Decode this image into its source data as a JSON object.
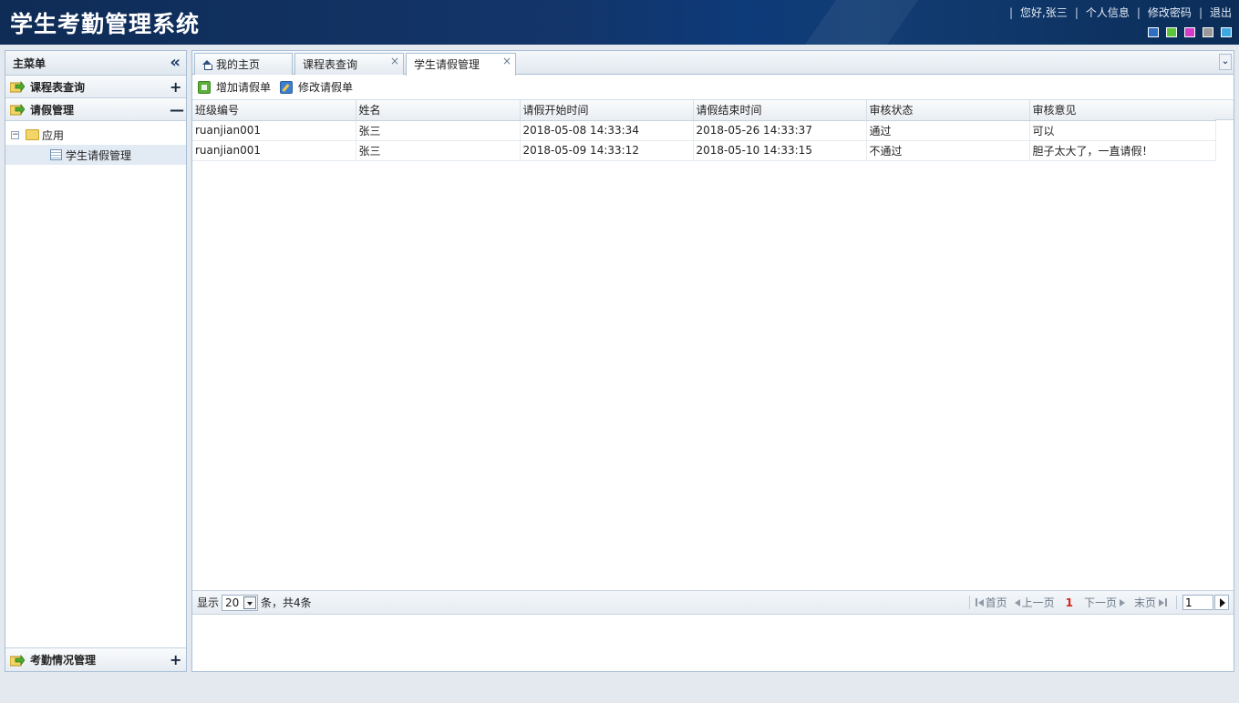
{
  "header": {
    "title": "学生考勤管理系统",
    "greeting": "您好,张三",
    "links": [
      "个人信息",
      "修改密码",
      "退出"
    ],
    "theme_colors": [
      "#2d6fc2",
      "#5cc43a",
      "#d63ac8",
      "#9a9a9a",
      "#40a8e0"
    ]
  },
  "sidebar": {
    "title": "主菜单",
    "panels": [
      {
        "label": "课程表查询",
        "toggle": "+"
      },
      {
        "label": "请假管理",
        "toggle": "—"
      },
      {
        "label": "考勤情况管理",
        "toggle": "+"
      }
    ],
    "tree": {
      "folder": "应用",
      "expander": "−",
      "item": "学生请假管理"
    }
  },
  "tabs": [
    {
      "label": "我的主页"
    },
    {
      "label": "课程表查询",
      "close": "×"
    },
    {
      "label": "学生请假管理",
      "close": "×"
    }
  ],
  "tab_menu": "¥",
  "toolbar": {
    "add_label": "增加请假单",
    "edit_label": "修改请假单"
  },
  "grid": {
    "columns": [
      "班级编号",
      "姓名",
      "请假开始时间",
      "请假结束时间",
      "审核状态",
      "审核意见"
    ],
    "rows": [
      [
        "ruanjian001",
        "张三",
        "2018-05-08 14:33:34",
        "2018-05-26 14:33:37",
        "通过",
        "可以"
      ],
      [
        "ruanjian001",
        "张三",
        "2018-05-09 14:33:12",
        "2018-05-10 14:33:15",
        "不通过",
        "胆子太大了，一直请假！"
      ]
    ]
  },
  "pager": {
    "show_label": "显示",
    "page_size": "20",
    "total_text": "条，共4条",
    "first": "首页",
    "prev": "上一页",
    "current": "1",
    "next": "下一页",
    "last": "末页",
    "goto_value": "1"
  }
}
